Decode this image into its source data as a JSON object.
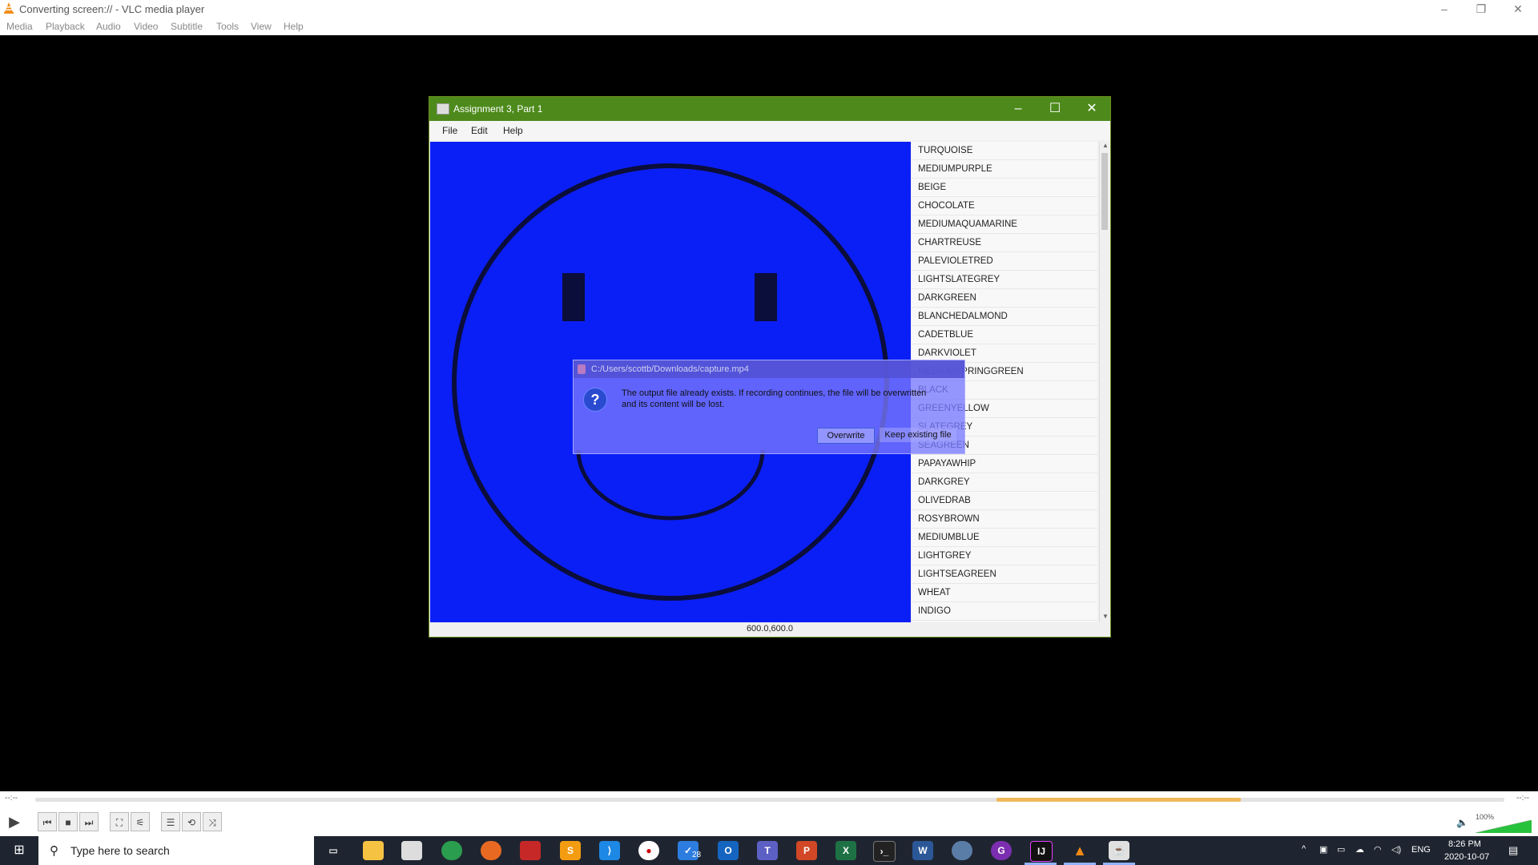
{
  "vlc": {
    "window_title": "Converting screen:// - VLC media player",
    "window_buttons": {
      "minimize": "–",
      "maximize": "❐",
      "close": "✕"
    },
    "menu": [
      "Media",
      "Playback",
      "Audio",
      "Video",
      "Subtitle",
      "Tools",
      "View",
      "Help"
    ],
    "time_left": "--:--",
    "time_right": "--:--",
    "volume_label": "100%",
    "volume_level": 1.0,
    "buffer_color": "#f0b85a"
  },
  "app": {
    "title": "Assignment 3, Part 1",
    "title_color": "#4d8a1b",
    "window_buttons": {
      "minimize": "–",
      "maximize": "☐",
      "close": "✕"
    },
    "menu": [
      "File",
      "Edit",
      "Help"
    ],
    "canvas_color": "#0a1ff5",
    "coordinates": "600.0,600.0",
    "colors": [
      "TURQUOISE",
      "MEDIUMPURPLE",
      "BEIGE",
      "CHOCOLATE",
      "MEDIUMAQUAMARINE",
      "CHARTREUSE",
      "PALEVIOLETRED",
      "LIGHTSLATEGREY",
      "DARKGREEN",
      "BLANCHEDALMOND",
      "CADETBLUE",
      "DARKVIOLET",
      "MEDIUMSPRINGGREEN",
      "BLACK",
      "GREENYELLOW",
      "SLATEGREY",
      "SEAGREEN",
      "PAPAYAWHIP",
      "DARKGREY",
      "OLIVEDRAB",
      "ROSYBROWN",
      "MEDIUMBLUE",
      "LIGHTGREY",
      "LIGHTSEAGREEN",
      "WHEAT",
      "INDIGO"
    ]
  },
  "dialog": {
    "title": "C:/Users/scottb/Downloads/capture.mp4",
    "line1": "The output file already exists. If recording continues, the file will be overwritten",
    "line2": "and its content will be lost.",
    "overwrite": "Overwrite",
    "keep": "Keep existing file",
    "icon": "?"
  },
  "taskbar": {
    "search_placeholder": "Type here to search",
    "tray_lang": "ENG",
    "time": "8:26 PM",
    "date": "2020-10-07",
    "badge_count": "28"
  }
}
